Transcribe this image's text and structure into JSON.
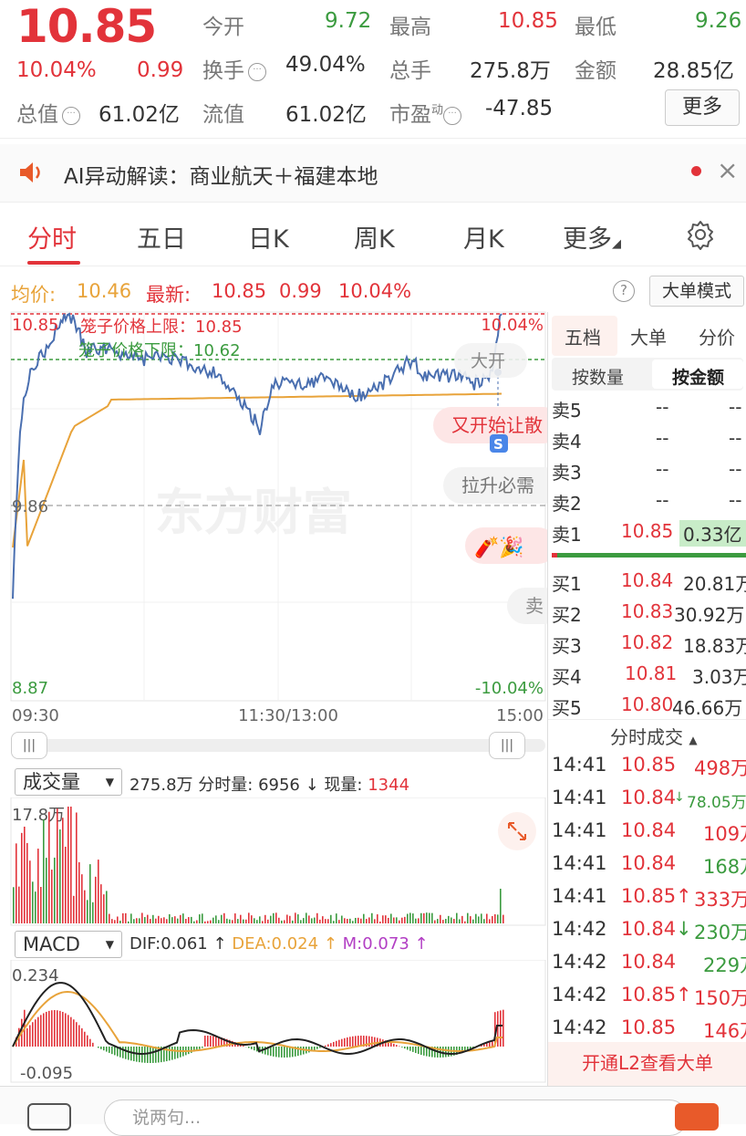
{
  "quote": {
    "price": "10.85",
    "change_pct": "10.04%",
    "change": "0.99",
    "open_label": "今开",
    "open": "9.72",
    "high_label": "最高",
    "high": "10.85",
    "low_label": "最低",
    "low": "9.26",
    "turnover_label": "换手",
    "turnover": "49.04%",
    "volume_label": "总手",
    "volume": "275.8万",
    "amount_label": "金额",
    "amount": "28.85亿",
    "mktcap_label": "总值",
    "mktcap": "61.02亿",
    "float_label": "流值",
    "float": "61.02亿",
    "pe_label": "市盈",
    "pe_sup": "动",
    "pe": "-47.85",
    "more_button": "更多"
  },
  "news": {
    "text": "AI异动解读：商业航天＋福建本地",
    "close": "×"
  },
  "tabs": [
    {
      "label": "分时",
      "active": true
    },
    {
      "label": "五日"
    },
    {
      "label": "日K"
    },
    {
      "label": "周K"
    },
    {
      "label": "月K"
    },
    {
      "label": "更多"
    }
  ],
  "infobar": {
    "avg_label": "均价:",
    "avg": "10.46",
    "latest_label": "最新:",
    "latest": "10.85",
    "latest_chg": "0.99",
    "latest_pct": "10.04%",
    "help": "?",
    "mode_button": "大单模式"
  },
  "chart": {
    "y_top": "10.85",
    "y_mid": "9.86",
    "y_bot": "8.87",
    "pct_top": "10.04%",
    "pct_bot": "-10.04%",
    "upper_limit_label": "笼子价格上限：10.85",
    "lower_limit_label": "笼子价格下限：10.62",
    "watermark": "东方财富",
    "t_start": "09:30",
    "t_mid": "11:30/13:00",
    "t_end": "15:00",
    "bubble_big": "大开",
    "bubble_red": "又开始让散",
    "bubble_gray": "拉升必需",
    "bubble_sell": "卖",
    "s_badge": "S",
    "colors": {
      "price": "#4a6fb0",
      "avg": "#e8a33a",
      "up": "#e2333a",
      "down": "#3b9b3f"
    }
  },
  "volume": {
    "selector": "成交量",
    "summary_total": "275.8万",
    "summary_label": "分时量:",
    "summary_minute": "6956",
    "now_label": "现量:",
    "now": "1344",
    "max_label": "17.8万"
  },
  "macd": {
    "selector": "MACD",
    "dif": "DIF:0.061",
    "dea": "DEA:0.024",
    "m": "M:0.073",
    "top": "0.234",
    "bot": "-0.095"
  },
  "orderbook": {
    "tabs": [
      "五档",
      "大单",
      "分价"
    ],
    "subtabs": [
      "按数量",
      "按金额"
    ],
    "asks": [
      {
        "label": "卖5",
        "price": "--",
        "amount": "--"
      },
      {
        "label": "卖4",
        "price": "--",
        "amount": "--"
      },
      {
        "label": "卖3",
        "price": "--",
        "amount": "--"
      },
      {
        "label": "卖2",
        "price": "--",
        "amount": "--"
      },
      {
        "label": "卖1",
        "price": "10.85",
        "amount": "0.33亿"
      }
    ],
    "bids": [
      {
        "label": "买1",
        "price": "10.84",
        "amount": "20.81万"
      },
      {
        "label": "买2",
        "price": "10.83",
        "amount": "30.92万"
      },
      {
        "label": "买3",
        "price": "10.82",
        "amount": "18.83万"
      },
      {
        "label": "买4",
        "price": "10.81",
        "amount": "3.03万"
      },
      {
        "label": "买5",
        "price": "10.80",
        "amount": "46.66万"
      }
    ],
    "trades_header": "分时成交",
    "trades": [
      {
        "time": "14:41",
        "price": "10.85",
        "arrow": "",
        "amount": "498万"
      },
      {
        "time": "14:41",
        "price": "10.84",
        "arrow": "↓",
        "amount": "78.05万"
      },
      {
        "time": "14:41",
        "price": "10.84",
        "arrow": "",
        "amount": "109万"
      },
      {
        "time": "14:41",
        "price": "10.84",
        "arrow": "",
        "amount": "168万"
      },
      {
        "time": "14:41",
        "price": "10.85",
        "arrow": "↑",
        "amount": "333万"
      },
      {
        "time": "14:42",
        "price": "10.84",
        "arrow": "↓",
        "amount": "230万"
      },
      {
        "time": "14:42",
        "price": "10.84",
        "arrow": "",
        "amount": "229万"
      },
      {
        "time": "14:42",
        "price": "10.85",
        "arrow": "↑",
        "amount": "150万"
      },
      {
        "time": "14:42",
        "price": "10.85",
        "arrow": "",
        "amount": "146万"
      }
    ],
    "l2_button": "开通L2查看大单"
  },
  "bottom": {
    "placeholder": "说两句..."
  }
}
